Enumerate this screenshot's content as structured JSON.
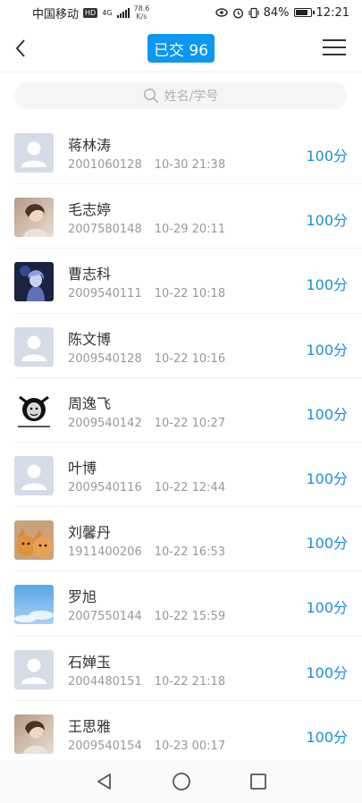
{
  "status_bar": {
    "carrier": "中国移动",
    "hd": "HD",
    "net_type": "4G",
    "net_speed_value": "78.6",
    "net_speed_unit": "K/s",
    "battery": "84%",
    "time": "12:21"
  },
  "header": {
    "title": "已交 96"
  },
  "search": {
    "placeholder": "姓名/学号"
  },
  "students": [
    {
      "name": "蒋林涛",
      "id": "2001060128",
      "time": "10-30 21:38",
      "score": "100分",
      "avatar": "default-avatar"
    },
    {
      "name": "毛志婷",
      "id": "2007580148",
      "time": "10-29 20:11",
      "score": "100分",
      "avatar": "photo-avatar"
    },
    {
      "name": "曹志科",
      "id": "2009540111",
      "time": "10-22 10:18",
      "score": "100分",
      "avatar": "anime-avatar"
    },
    {
      "name": "陈文博",
      "id": "2009540128",
      "time": "10-22 10:16",
      "score": "100分",
      "avatar": "default-avatar"
    },
    {
      "name": "周逸飞",
      "id": "2009540142",
      "time": "10-22 10:27",
      "score": "100分",
      "avatar": "meme-avatar"
    },
    {
      "name": "叶博",
      "id": "2009540116",
      "time": "10-22 12:44",
      "score": "100分",
      "avatar": "default-avatar"
    },
    {
      "name": "刘馨丹",
      "id": "1911400206",
      "time": "10-22 16:53",
      "score": "100分",
      "avatar": "cat-avatar"
    },
    {
      "name": "罗旭",
      "id": "2007550144",
      "time": "10-22 15:59",
      "score": "100分",
      "avatar": "sky-avatar"
    },
    {
      "name": "石婵玉",
      "id": "2004480151",
      "time": "10-22 21:18",
      "score": "100分",
      "avatar": "default-avatar"
    },
    {
      "name": "王思雅",
      "id": "2009540154",
      "time": "10-23 00:17",
      "score": "100分",
      "avatar": "photo-avatar"
    }
  ],
  "colors": {
    "accent": "#0d96f2",
    "score": "#1a90d6"
  }
}
